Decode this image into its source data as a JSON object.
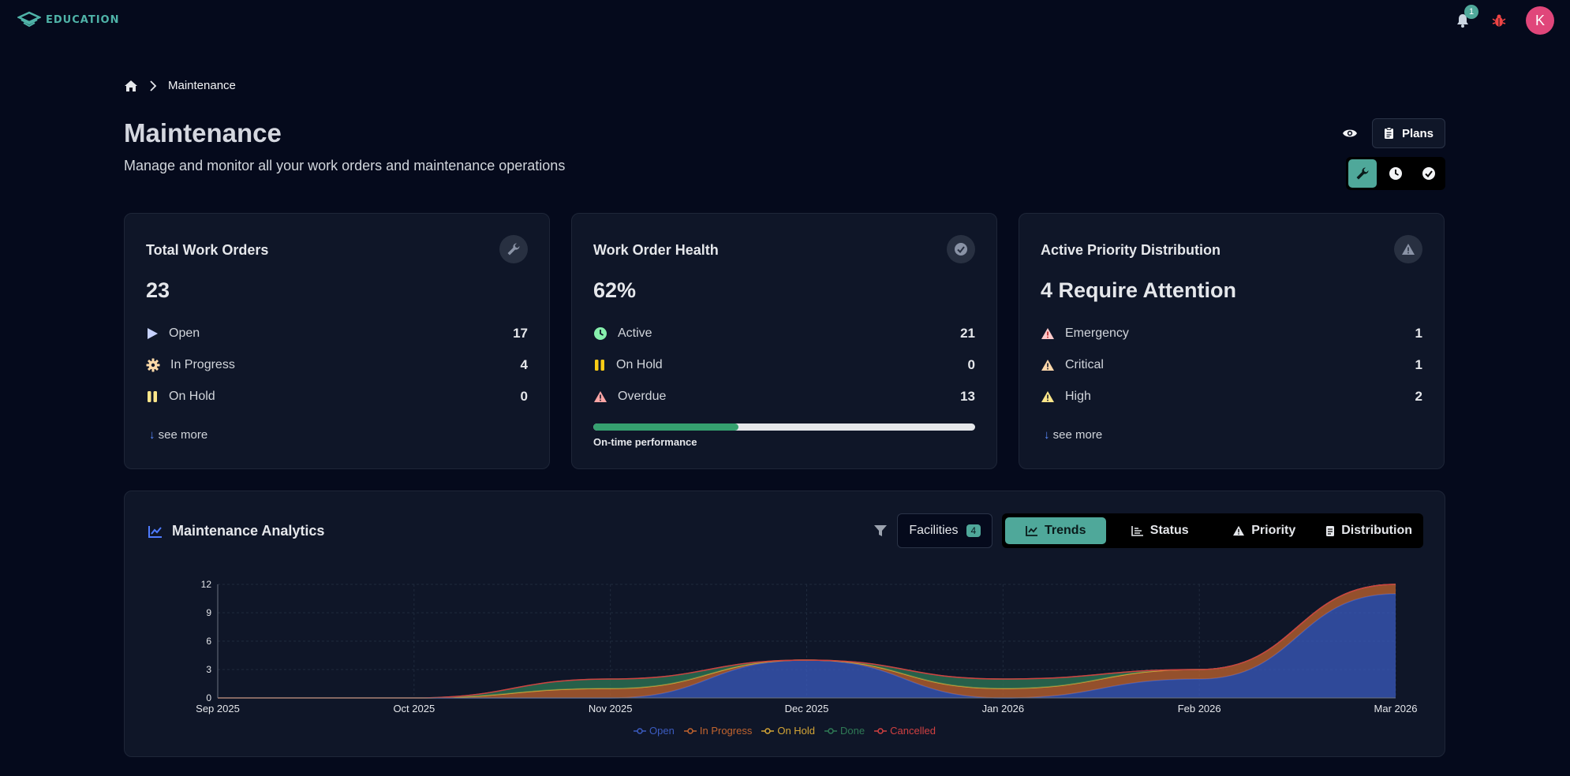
{
  "brand": {
    "name": "EDUCATION",
    "accent": "#4fb3a8"
  },
  "topbar": {
    "notification_count": "1",
    "avatar_initial": "K",
    "avatar_color": "#e0467a"
  },
  "breadcrumb": {
    "home_icon": "home-icon",
    "current": "Maintenance"
  },
  "header": {
    "title": "Maintenance",
    "subtitle": "Manage and monitor all your work orders and maintenance operations",
    "plans_label": "Plans"
  },
  "cards": {
    "total": {
      "title": "Total Work Orders",
      "value": "23",
      "rows": [
        {
          "label": "Open",
          "value": "17",
          "icon": "play-icon"
        },
        {
          "label": "In Progress",
          "value": "4",
          "icon": "gear-icon"
        },
        {
          "label": "On Hold",
          "value": "0",
          "icon": "pause-icon"
        }
      ],
      "see_more": "see more"
    },
    "health": {
      "title": "Work Order Health",
      "value": "62%",
      "rows": [
        {
          "label": "Active",
          "value": "21",
          "icon": "clock-icon"
        },
        {
          "label": "On Hold",
          "value": "0",
          "icon": "pause-icon"
        },
        {
          "label": "Overdue",
          "value": "13",
          "icon": "warning-icon"
        }
      ],
      "on_time_fraction": 0.38,
      "progress_label": "On-time performance"
    },
    "priority": {
      "title": "Active Priority Distribution",
      "value": "4 Require Attention",
      "rows": [
        {
          "label": "Emergency",
          "value": "1",
          "icon": "warning-icon"
        },
        {
          "label": "Critical",
          "value": "1",
          "icon": "warning-icon"
        },
        {
          "label": "High",
          "value": "2",
          "icon": "warning-icon"
        }
      ],
      "see_more": "see more"
    }
  },
  "analytics": {
    "title": "Maintenance Analytics",
    "facilities_label": "Facilities",
    "facilities_count": "4",
    "tabs": [
      "Trends",
      "Status",
      "Priority",
      "Distribution"
    ],
    "active_tab": "Trends"
  },
  "chart_data": {
    "type": "area",
    "stacked": true,
    "x": [
      "Sep 2025",
      "Oct 2025",
      "Nov 2025",
      "Dec 2025",
      "Jan 2026",
      "Feb 2026",
      "Mar 2026"
    ],
    "ylim": [
      0,
      12
    ],
    "yticks": [
      0,
      3,
      6,
      9,
      12
    ],
    "grid": true,
    "legend_position": "bottom",
    "series": [
      {
        "name": "Open",
        "color": "#3b5bbf",
        "values": [
          0,
          0,
          0,
          4,
          0,
          2,
          11
        ]
      },
      {
        "name": "In Progress",
        "color": "#c2642e",
        "values": [
          0,
          0,
          1,
          0,
          1,
          1,
          1
        ]
      },
      {
        "name": "On Hold",
        "color": "#d4a536",
        "values": [
          0,
          0,
          0,
          0,
          0,
          0,
          0
        ]
      },
      {
        "name": "Done",
        "color": "#2f7a55",
        "values": [
          0,
          0,
          1,
          0,
          1,
          0,
          0
        ]
      },
      {
        "name": "Cancelled",
        "color": "#d04040",
        "values": [
          0,
          0,
          0,
          0,
          0,
          0,
          0
        ]
      }
    ]
  }
}
